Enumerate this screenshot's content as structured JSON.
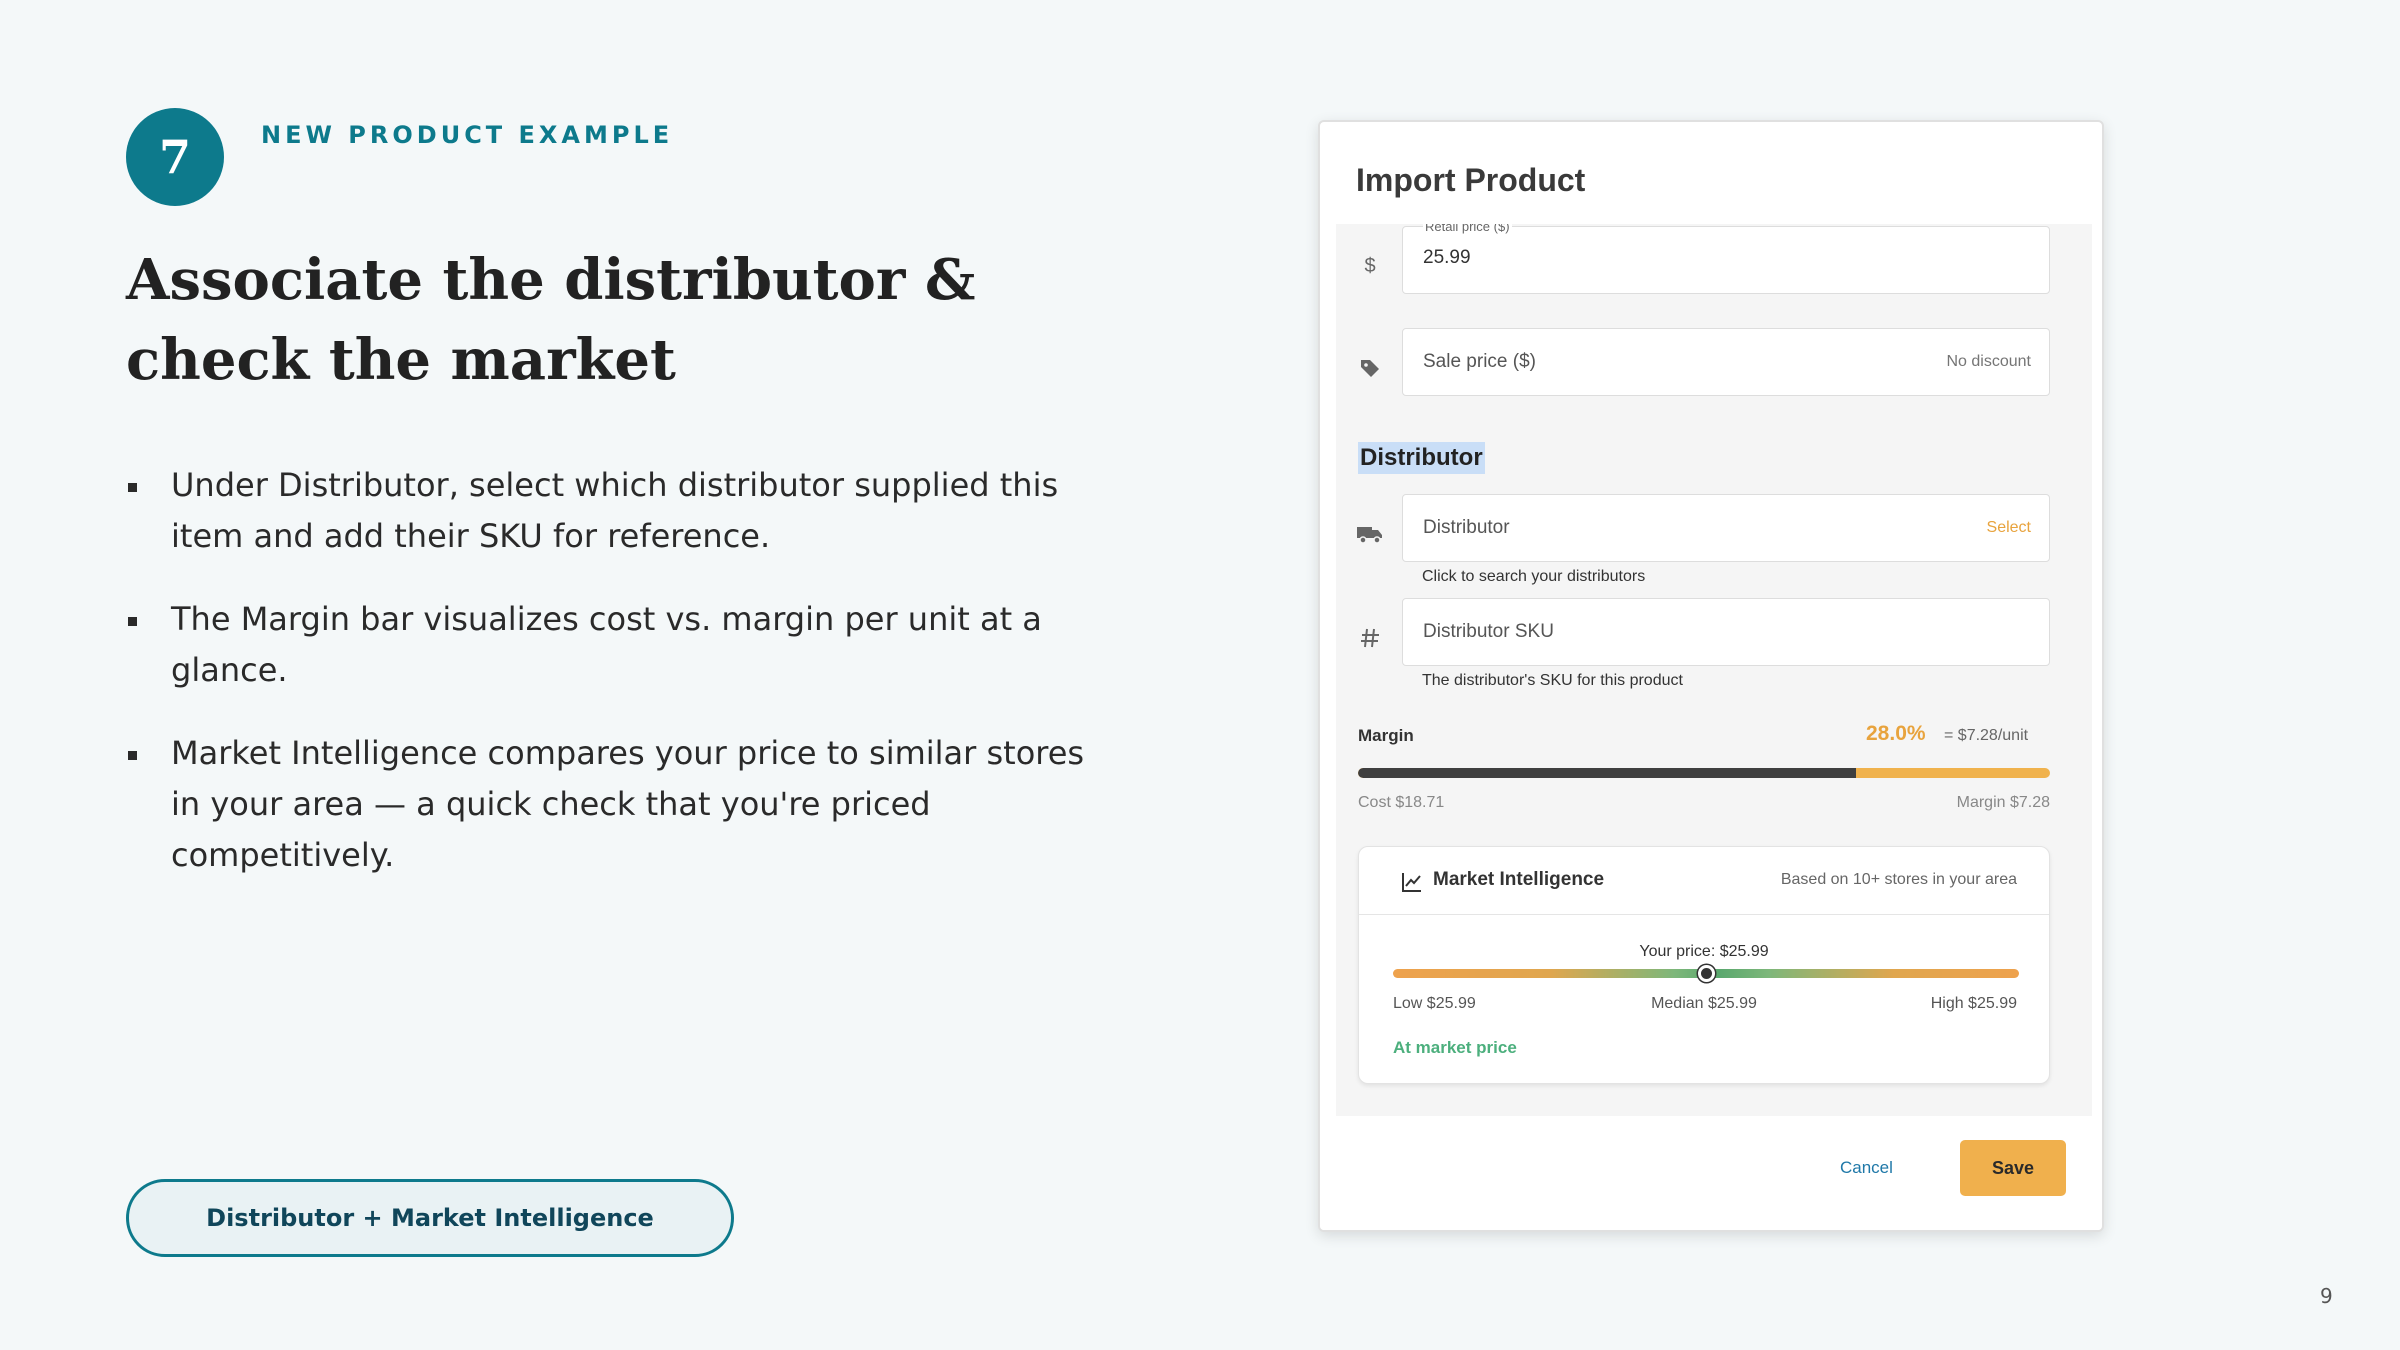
{
  "slide": {
    "step_number": "7",
    "eyebrow": "NEW PRODUCT EXAMPLE",
    "title": "Associate the distributor & check the market",
    "bullets": [
      "Under Distributor, select which distributor supplied this item and add their SKU for reference.",
      "The Margin bar visualizes cost vs. margin per unit at a glance.",
      "Market Intelligence compares your price to similar stores in your area — a quick check that you're priced competitively."
    ],
    "pill_label": "Distributor + Market Intelligence",
    "page_number": "9"
  },
  "dialog": {
    "title": "Import Product",
    "retail_price": {
      "label": "Retail price ($)",
      "value": "25.99",
      "icon": "dollar-icon"
    },
    "sale_price": {
      "placeholder": "Sale price ($)",
      "suffix": "No discount",
      "icon": "tag-icon"
    },
    "distributor_section_title": "Distributor",
    "distributor": {
      "placeholder": "Distributor",
      "action": "Select",
      "helper": "Click to search your distributors",
      "icon": "truck-icon"
    },
    "distributor_sku": {
      "placeholder": "Distributor SKU",
      "helper": "The distributor's SKU for this product",
      "icon": "hash-icon"
    },
    "margin": {
      "label": "Margin",
      "percent_text": "28.0%",
      "per_unit_text": "= $7.28/unit",
      "cost_fraction": 0.72,
      "cost_label": "Cost $18.71",
      "margin_label": "Margin $7.28"
    },
    "market_intelligence": {
      "title": "Market Intelligence",
      "subtitle": "Based on 10+ stores in your area",
      "icon": "trend-chart-icon",
      "your_price_text": "Your price: $25.99",
      "position_fraction": 0.5,
      "low_text": "Low $25.99",
      "median_text": "Median $25.99",
      "high_text": "High $25.99",
      "status_text": "At market price"
    },
    "footer": {
      "cancel_label": "Cancel",
      "save_label": "Save"
    }
  },
  "colors": {
    "teal": "#0d7a8c",
    "accent_orange": "#f0b04d",
    "market_green": "#4caf7d",
    "highlight": "#c9def7"
  }
}
